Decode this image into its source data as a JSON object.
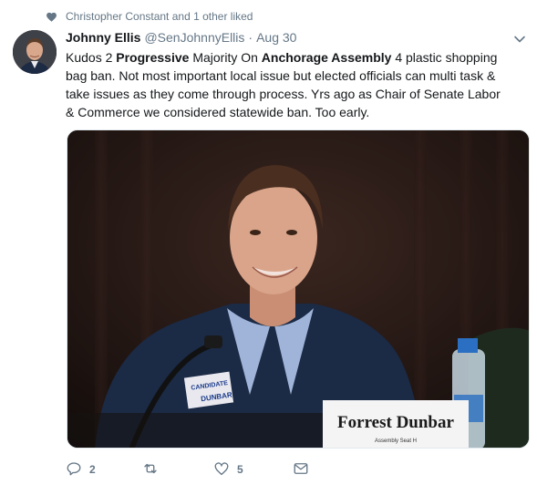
{
  "social_context": {
    "text": "Christopher Constant and 1 other liked",
    "icon": "heart-icon"
  },
  "author": {
    "fullname": "Johnny Ellis",
    "handle": "@SenJohnnyEllis",
    "separator": "·",
    "time": "Aug 30"
  },
  "tweet": {
    "segments": [
      {
        "text": "Kudos 2 ",
        "bold": false
      },
      {
        "text": "Progressive",
        "bold": true
      },
      {
        "text": " Majority On ",
        "bold": false
      },
      {
        "text": "Anchorage Assembly",
        "bold": true
      },
      {
        "text": " 4 plastic shopping bag ban. Not most important local issue but elected officials can multi task & take issues as they come through process. Yrs ago as Chair of Senate Labor & Commerce we considered statewide ban. Too early.",
        "bold": false
      }
    ]
  },
  "media": {
    "badge_text": "CANDIDATE",
    "badge_name": "DUNBAR",
    "placard_name": "Forrest Dunbar",
    "placard_sub": "Assembly Seat H"
  },
  "actions": {
    "reply_count": "2",
    "retweet_count": "",
    "like_count": "5"
  },
  "colors": {
    "text_primary": "#14171a",
    "text_secondary": "#657786",
    "border": "#e1e8ed"
  }
}
